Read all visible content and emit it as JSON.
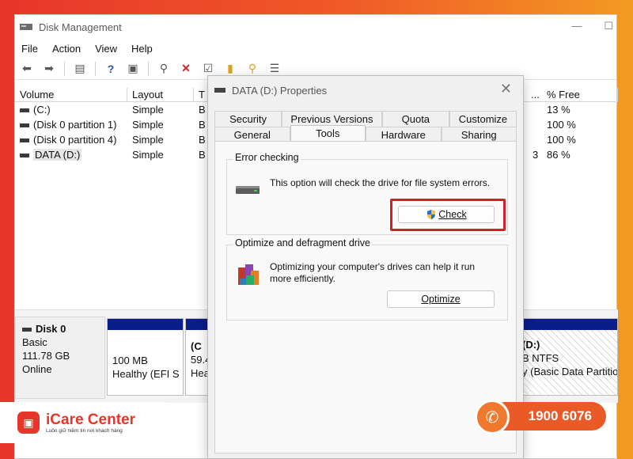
{
  "window": {
    "title": "Disk Management",
    "icon": "disk-management-icon"
  },
  "menu": [
    "File",
    "Action",
    "View",
    "Help"
  ],
  "toolbar": [
    "back-icon",
    "forward-icon",
    "properties-icon",
    "help-icon",
    "refresh-icon",
    "connect-icon",
    "delete-icon",
    "check-icon",
    "folder-up-icon",
    "search-icon",
    "list-icon"
  ],
  "volumes": {
    "headers": {
      "volume": "Volume",
      "layout": "Layout",
      "type": "T",
      "extra": "...",
      "pct_free": "% Free"
    },
    "rows": [
      {
        "volume": "(C:)",
        "layout": "Simple",
        "type": "B",
        "extra": "",
        "pct_free": "13 %"
      },
      {
        "volume": "(Disk 0 partition 1)",
        "layout": "Simple",
        "type": "B",
        "extra": "",
        "pct_free": "100 %"
      },
      {
        "volume": "(Disk 0 partition 4)",
        "layout": "Simple",
        "type": "B",
        "extra": "",
        "pct_free": "100 %"
      },
      {
        "volume": "DATA (D:)",
        "layout": "Simple",
        "type": "B",
        "extra": "3",
        "pct_free": "86 %"
      }
    ]
  },
  "disk": {
    "name": "Disk 0",
    "kind": "Basic",
    "size": "111.78 GB",
    "status": "Online",
    "partitions": [
      {
        "line1": "100 MB",
        "line2": "Healthy (EFI S"
      },
      {
        "line1": "(C",
        "line2": "59.4",
        "line3": "Hea"
      },
      {
        "line1": "(D:)",
        "line2": "B NTFS",
        "line3": "y (Basic Data Partitio"
      }
    ]
  },
  "dialog": {
    "title": "DATA (D:) Properties",
    "tabs_top": [
      "Security",
      "Previous Versions",
      "Quota",
      "Customize"
    ],
    "tabs_bottom": [
      "General",
      "Tools",
      "Hardware",
      "Sharing"
    ],
    "active_tab": "Tools",
    "error_checking": {
      "title": "Error checking",
      "text": "This option will check the drive for file system errors.",
      "button": "Check"
    },
    "optimize": {
      "title": "Optimize and defragment drive",
      "text": "Optimizing your computer's drives can help it run more efficiently.",
      "button": "Optimize"
    }
  },
  "brand": {
    "name": "iCare Center",
    "tagline": "Luôn giữ niềm tin nơi khách hàng",
    "phone": "1900 6076"
  },
  "colors": {
    "accent_red": "#d3202a",
    "partition_bar": "#0b1d8a",
    "brand_orange": "#ea5a27"
  }
}
